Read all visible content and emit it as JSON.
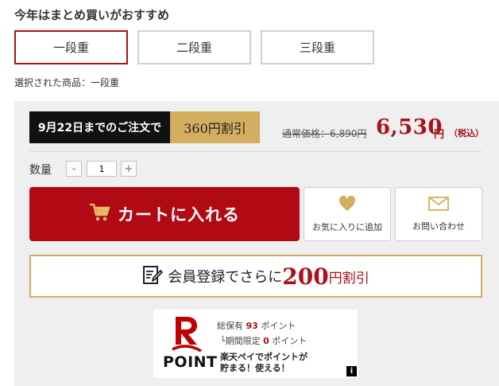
{
  "section_title": "今年はまとめ買いがおすすめ",
  "options": [
    {
      "label": "一段重",
      "selected": true
    },
    {
      "label": "二段重",
      "selected": false
    },
    {
      "label": "三段重",
      "selected": false
    }
  ],
  "selected_product_text": "選択された商品：一段重",
  "promo": {
    "deadline": "9月22日までのご注文で",
    "discount": "360円割引"
  },
  "price": {
    "regular": "通常価格：6,890円",
    "current": "6,530",
    "unit": "円",
    "tax": "（税込）"
  },
  "quantity": {
    "label": "数量",
    "minus": "-",
    "value": "1",
    "plus": "+"
  },
  "buttons": {
    "cart": "カートに入れる",
    "favorite": "お気に入りに追加",
    "inquiry": "お問い合わせ"
  },
  "member": {
    "prefix": "会員登録でさらに",
    "amount": "200",
    "suffix": "円割引"
  },
  "rakuten_point": {
    "logo_word": "POINT",
    "held_pre": "総保有",
    "held_value": "93",
    "held_post": "ポイント",
    "limited_pre": "└期間限定",
    "limited_value": "0",
    "limited_post": "ポイント",
    "promo_line1": "楽天ペイでポイントが",
    "promo_line2": "貯まる！使える！",
    "info_icon": "i"
  },
  "colors": {
    "accent_red": "#b10a14",
    "gold": "#d4ae60",
    "panel_gray": "#efefef"
  }
}
